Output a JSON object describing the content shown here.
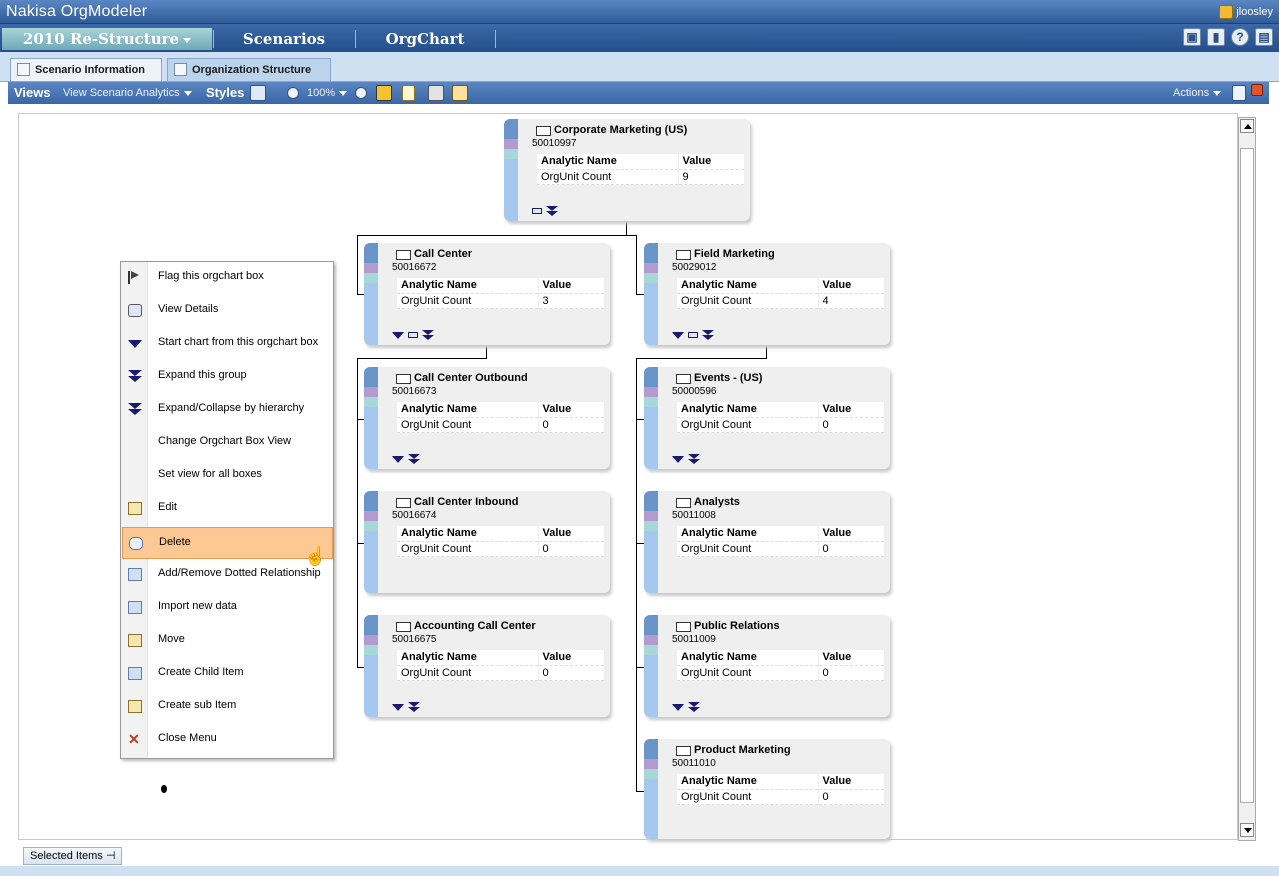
{
  "app": {
    "title": "Nakisa OrgModeler",
    "user": "jloosley"
  },
  "mainnav": {
    "scenario": "2010 Re-Structure",
    "tabs": [
      "Scenarios",
      "OrgChart"
    ]
  },
  "subtabs": [
    "Scenario Information",
    "Organization Structure"
  ],
  "toolbar": {
    "views": "Views",
    "analytics": "View Scenario Analytics",
    "styles": "Styles",
    "zoom": "100%",
    "actions": "Actions"
  },
  "table_headers": {
    "name": "Analytic Name",
    "value": "Value"
  },
  "boxes": [
    {
      "title": "Corporate Marketing (US)",
      "id": "50010997",
      "analytic": "OrgUnit Count",
      "value": "9"
    },
    {
      "title": "Call Center",
      "id": "50016672",
      "analytic": "OrgUnit Count",
      "value": "3"
    },
    {
      "title": "Field Marketing",
      "id": "50029012",
      "analytic": "OrgUnit Count",
      "value": "4"
    },
    {
      "title": "Call Center Outbound",
      "id": "50016673",
      "analytic": "OrgUnit Count",
      "value": "0"
    },
    {
      "title": "Events - (US)",
      "id": "50000596",
      "analytic": "OrgUnit Count",
      "value": "0"
    },
    {
      "title": "Call Center Inbound",
      "id": "50016674",
      "analytic": "OrgUnit Count",
      "value": "0"
    },
    {
      "title": "Analysts",
      "id": "50011008",
      "analytic": "OrgUnit Count",
      "value": "0"
    },
    {
      "title": "Accounting Call Center",
      "id": "50016675",
      "analytic": "OrgUnit Count",
      "value": "0"
    },
    {
      "title": "Public Relations",
      "id": "50011009",
      "analytic": "OrgUnit Count",
      "value": "0"
    },
    {
      "title": "Product Marketing",
      "id": "50011010",
      "analytic": "OrgUnit Count",
      "value": "0"
    }
  ],
  "menu": [
    {
      "label": "Flag this orgchart box",
      "icon": "flag-icon"
    },
    {
      "label": "View Details",
      "icon": "details-icon"
    },
    {
      "label": "Start chart from this orgchart box",
      "icon": "start-chart-icon"
    },
    {
      "label": "Expand this group",
      "icon": "expand-icon"
    },
    {
      "label": "Expand/Collapse by hierarchy",
      "icon": "expand-collapse-icon"
    },
    {
      "label": "Change Orgchart Box View",
      "icon": ""
    },
    {
      "label": "Set view for all boxes",
      "icon": ""
    },
    {
      "label": "Edit",
      "icon": "edit-icon"
    },
    {
      "label": "Delete",
      "icon": "delete-icon"
    },
    {
      "label": "Add/Remove Dotted Relationship",
      "icon": "dotted-relationship-icon"
    },
    {
      "label": "Import new data",
      "icon": "import-icon"
    },
    {
      "label": "Move",
      "icon": "move-icon"
    },
    {
      "label": "Create Child Item",
      "icon": "create-child-icon"
    },
    {
      "label": "Create sub Item",
      "icon": "create-sub-icon"
    },
    {
      "label": "Close Menu",
      "icon": "close-icon"
    }
  ],
  "footer": {
    "selected_items": "Selected Items"
  }
}
